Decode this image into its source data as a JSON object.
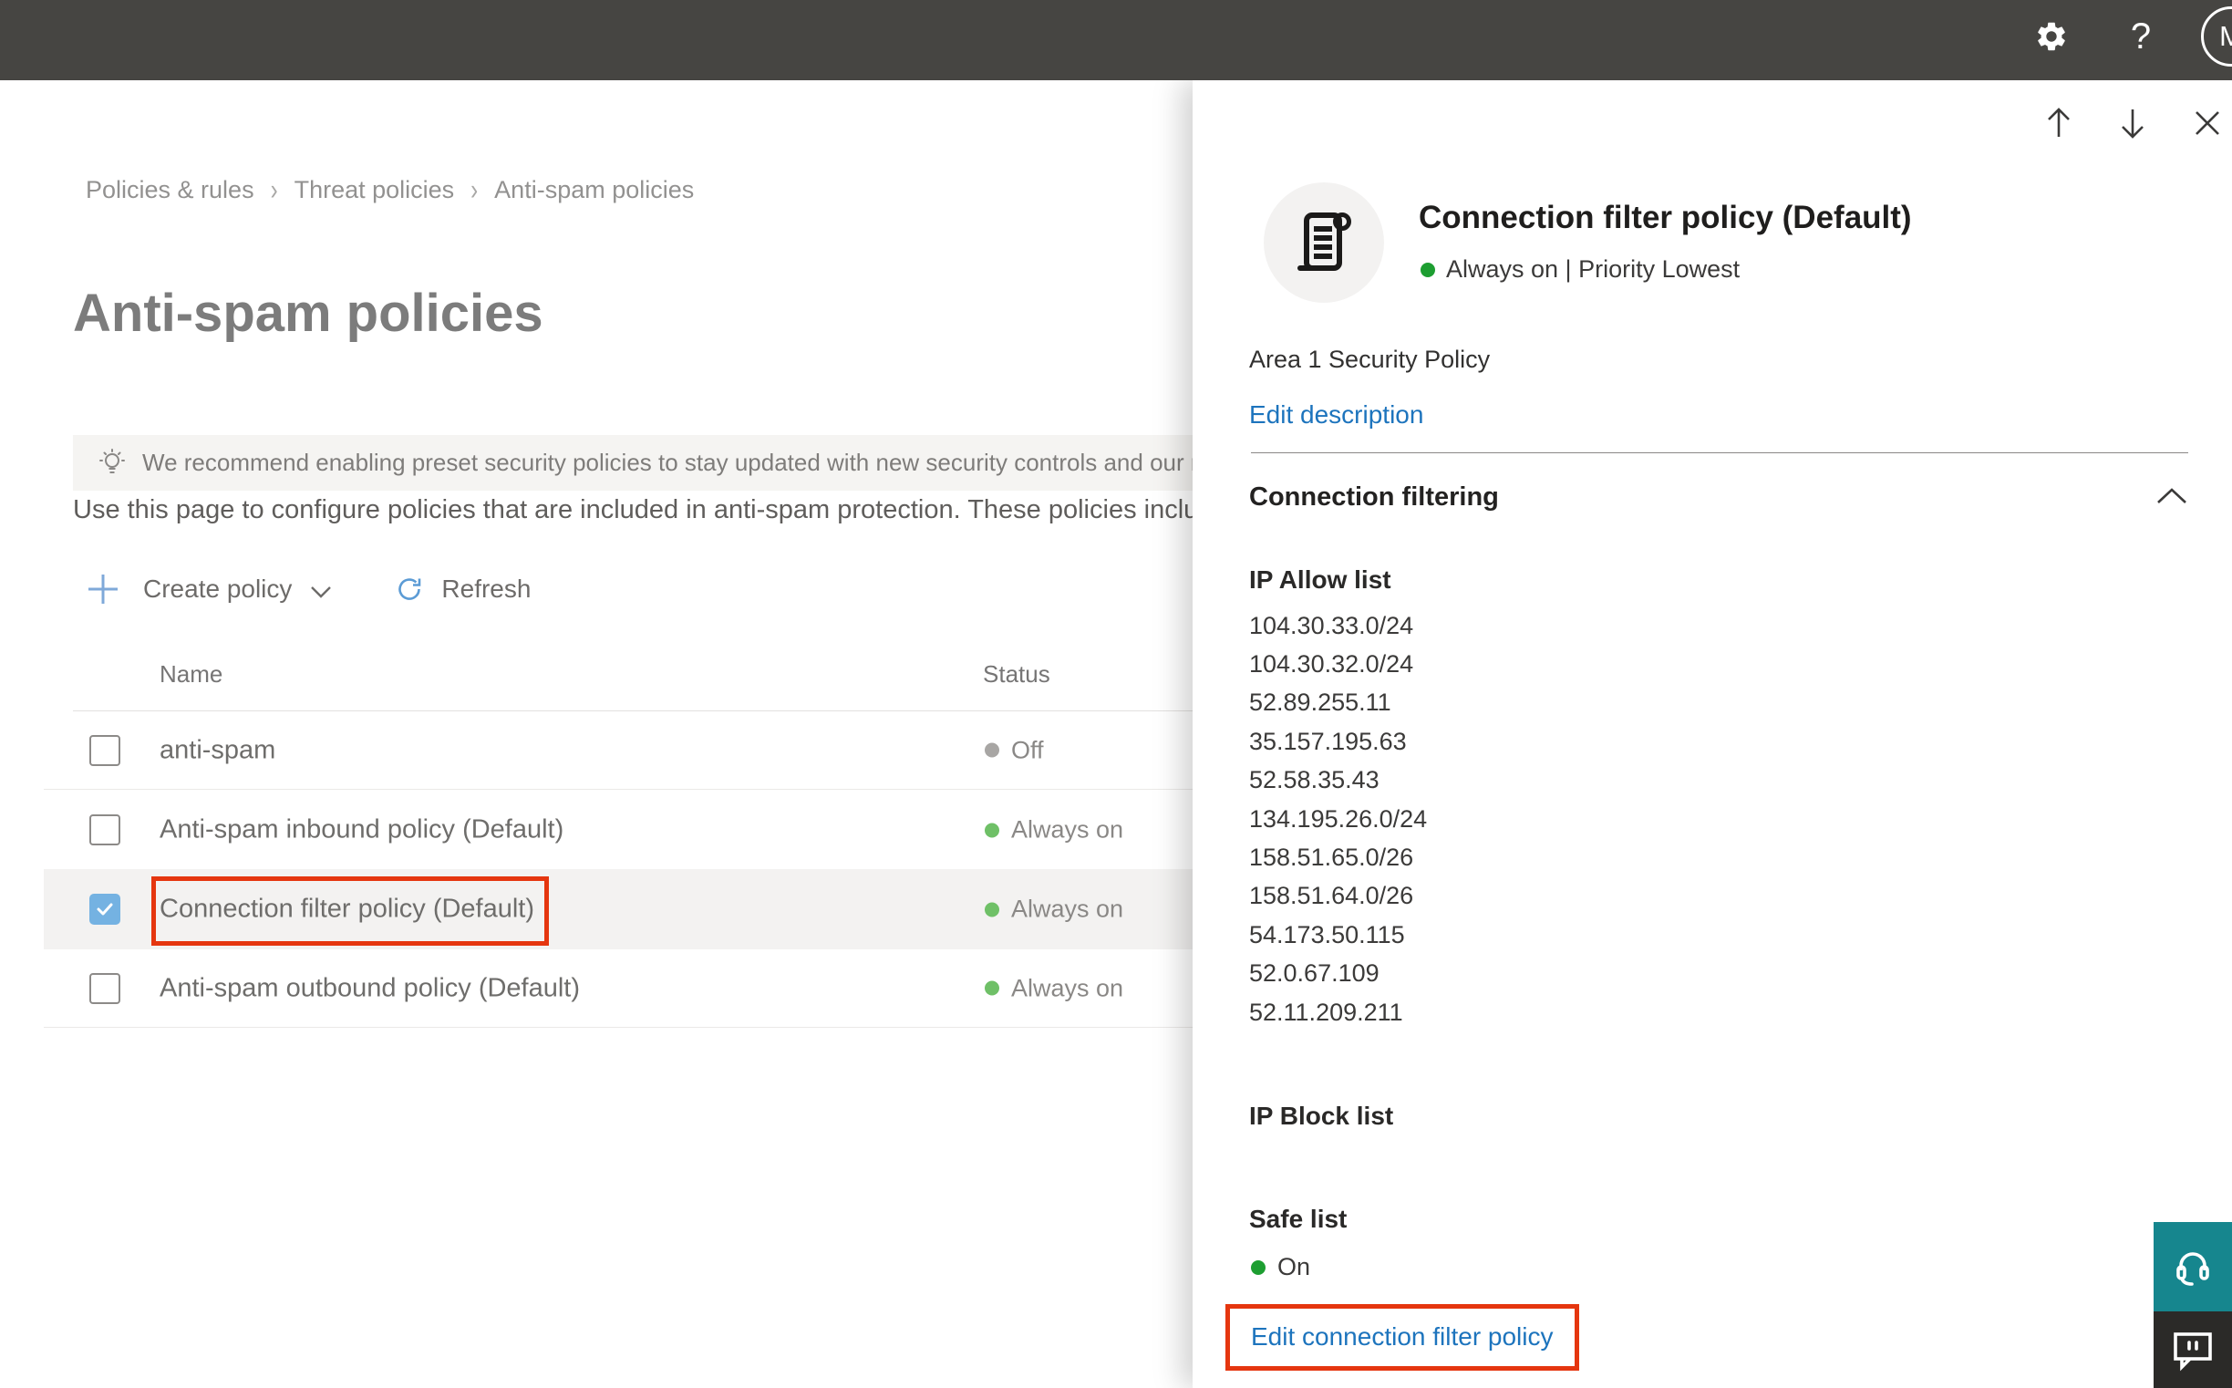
{
  "topbar": {
    "help_glyph": "?",
    "avatar_initial": "M"
  },
  "breadcrumb": {
    "separator": "›",
    "items": [
      "Policies & rules",
      "Threat policies",
      "Anti-spam policies"
    ]
  },
  "page": {
    "title": "Anti-spam policies",
    "banner_text": "We recommend enabling preset security policies to stay updated with new security controls and our recomme",
    "intro_text": "Use this page to configure policies that are included in anti-spam protection. These policies include",
    "create_policy_label": "Create policy",
    "refresh_label": "Refresh"
  },
  "table": {
    "columns": {
      "name": "Name",
      "status": "Status"
    },
    "rows": [
      {
        "name": "anti-spam",
        "status": "Off",
        "checked": false,
        "selected": false
      },
      {
        "name": "Anti-spam inbound policy (Default)",
        "status": "Always on",
        "checked": false,
        "selected": false
      },
      {
        "name": "Connection filter policy (Default)",
        "status": "Always on",
        "checked": true,
        "selected": true
      },
      {
        "name": "Anti-spam outbound policy (Default)",
        "status": "Always on",
        "checked": false,
        "selected": false
      }
    ]
  },
  "panel": {
    "title": "Connection filter policy (Default)",
    "status_line": "Always on | Priority Lowest",
    "description": "Area 1 Security Policy",
    "edit_description_label": "Edit description",
    "section_title": "Connection filtering",
    "ip_allow": {
      "title": "IP Allow list",
      "items": [
        "104.30.33.0/24",
        "104.30.32.0/24",
        "52.89.255.11",
        "35.157.195.63",
        "52.58.35.43",
        "134.195.26.0/24",
        "158.51.65.0/26",
        "158.51.64.0/26",
        "54.173.50.115",
        "52.0.67.109",
        "52.11.209.211"
      ]
    },
    "ip_block": {
      "title": "IP Block list"
    },
    "safe_list": {
      "title": "Safe list",
      "status": "On"
    },
    "edit_link_label": "Edit connection filter policy"
  },
  "colors": {
    "topbar_bg": "#464542",
    "accent_blue_link": "#1d74bd",
    "checkbox_checked_blue": "#74b2e2",
    "annotation_red": "#e5360f",
    "status_green_table": "#6fc067",
    "status_green_panel": "#1d9e31",
    "status_gray_off": "#a8a6a4",
    "support_teal": "#16868e",
    "feedback_dark": "#2b2a28",
    "selected_row_bg": "#f3f2f1"
  }
}
